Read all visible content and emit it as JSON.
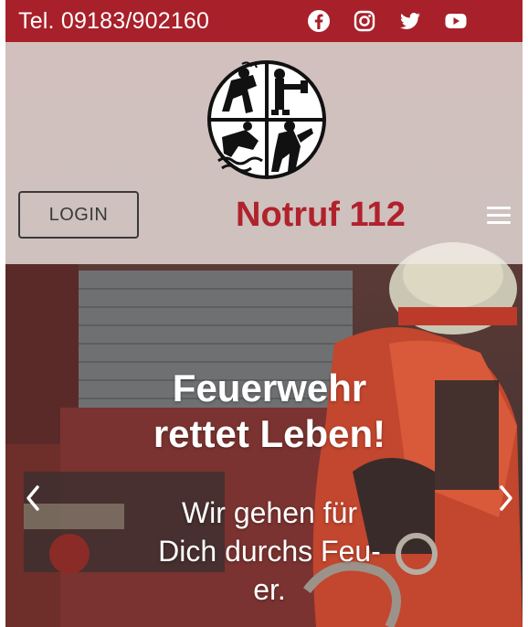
{
  "topbar": {
    "phone": "Tel. 09183/902160",
    "social": [
      {
        "icon": "facebook-icon"
      },
      {
        "icon": "instagram-icon"
      },
      {
        "icon": "twitter-icon"
      },
      {
        "icon": "youtube-icon"
      }
    ],
    "color": "#a8202a"
  },
  "header": {
    "logo_icon": "fire-department-emblem-icon",
    "login_label": "LOGIN",
    "emergency": "Notruf 112",
    "emergency_color": "#b0222c",
    "menu_icon": "hamburger-menu-icon"
  },
  "slider": {
    "title_line1": "Feuerwehr",
    "title_line2": "rettet Leben!",
    "sub_line1": "Wir gehen für",
    "sub_line2": "Dich durchs Feu-",
    "sub_line3": "er.",
    "prev_icon": "chevron-left-icon",
    "next_icon": "chevron-right-icon"
  }
}
